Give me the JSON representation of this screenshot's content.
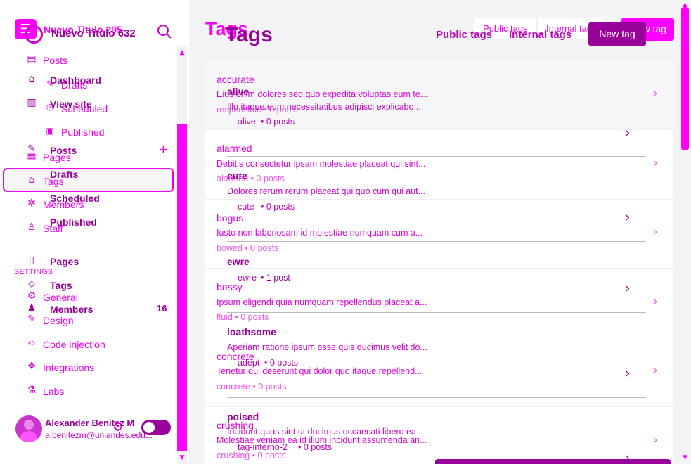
{
  "sidebar": {
    "brand_back": "Nuevo Titulo 295",
    "brand_front": "Nuevo Titulo 632",
    "nav_back": {
      "posts": "Posts",
      "drafts": "Drafts",
      "scheduled": "Scheduled",
      "published": "Published",
      "pages": "Pages",
      "tags": "Tags",
      "members": "Members",
      "staff": "Staff",
      "settings_header": "SETTINGS",
      "general": "General",
      "design": "Design",
      "code_injection": "Code injection",
      "integrations": "Integrations",
      "labs": "Labs"
    },
    "nav_front": {
      "dashboard": "Dashboard",
      "view_site": "View site",
      "posts": "Posts",
      "drafts": "Drafts",
      "scheduled": "Scheduled",
      "published": "Published",
      "pages": "Pages",
      "tags": "Tags",
      "members": "Members",
      "members_count": "16"
    },
    "user": {
      "name": "Alexander Benitez M",
      "email": "a.benitezm@uniandes.edu..."
    }
  },
  "header": {
    "title_back": "Tags",
    "title_front": "Tags",
    "filters_back": [
      "Public tags",
      "Internal tags"
    ],
    "filters_front": [
      "Public tags",
      "Internal tags"
    ],
    "new_tag_back": "New tag",
    "new_tag_front": "New tag"
  },
  "tags_back": [
    {
      "name": "accurate",
      "desc": "Eius enim dolores sed quo expedita voluptas eum te...",
      "meta": "responsible • 0 posts"
    },
    {
      "name": "alarmed",
      "desc": "Debitis consectetur ipsam molestiae placeat qui sint...",
      "meta": "alarmed • 0 posts"
    },
    {
      "name": "bogus",
      "desc": "Iusto non laboriosam id molestiae numquam cum a...",
      "meta": "bowed • 0 posts"
    },
    {
      "name": "bossy",
      "desc": "Ipsum eligendi quia numquam repellendus placeat a...",
      "meta": "fluid • 0 posts"
    },
    {
      "name": "concrete",
      "desc": "Tenetur qui deserunt qui dolor quo itaque repellend...",
      "meta": "concrete • 0 posts"
    },
    {
      "name": "crushing",
      "desc": "Molestiae veniam ea id illum incidunt assumenda an...",
      "meta": "crushing • 0 posts"
    }
  ],
  "tags_front": [
    {
      "name": "alive",
      "desc": "Illo itaque eum necessitatibus adipisci explicabo ...",
      "slug": "alive",
      "meta": "• 0 posts"
    },
    {
      "name": "cute",
      "desc": "Dolores rerum rerum placeat qui quo cum qui aut...",
      "slug": "cute",
      "meta": "• 0 posts"
    },
    {
      "name": "ewre",
      "desc": "",
      "slug": "ewre",
      "meta": "• 1 post"
    },
    {
      "name": "loathsome",
      "desc": "Aperiam ratione ipsum esse quis ducimus velit do...",
      "slug": "adept",
      "meta": "• 0 posts"
    },
    {
      "name": "poised",
      "desc": "Incidunt quos sint ut ducimus occaecati libero ea ...",
      "slug": "tag-interno-2",
      "meta": "• 0 posts"
    }
  ],
  "colors": {
    "accent": "#ff00ff",
    "accent_dark": "#990099",
    "background": "#f4f4f6"
  },
  "icons": [
    "menu-icon",
    "search-icon",
    "home-icon",
    "layout-icon",
    "posts-icon",
    "pages-icon",
    "tag-icon",
    "members-icon",
    "staff-icon",
    "settings-icon",
    "brush-icon",
    "code-icon",
    "integrations-icon",
    "flask-icon",
    "gear-icon",
    "plus-icon",
    "chevron-right-icon"
  ]
}
